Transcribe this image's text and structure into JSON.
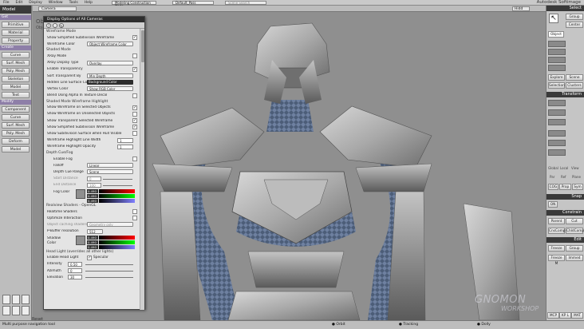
{
  "menubar": {
    "items": [
      "File",
      "Edit",
      "Display",
      "Window",
      "Tools",
      "Help"
    ],
    "mode_combo": "Modeling Construction Mode",
    "scene_combo": "Default_Pass",
    "search_placeholder": "Scene Search",
    "brand": "Autodesk Softimage"
  },
  "left_panel": {
    "header": "Model",
    "get_section": "Get",
    "get_buttons": [
      "Primitive",
      "Material",
      "Property"
    ],
    "create_section": "Create",
    "create_buttons": [
      "Curve",
      "Surf. Mesh",
      "Poly. Mesh",
      "Skeleton",
      "Model",
      "Text"
    ],
    "modify_section": "Modify",
    "modify_buttons": [
      "Component",
      "Curve",
      "Surf. Mesh",
      "Poly. Mesh",
      "Deform",
      "Model"
    ]
  },
  "viewport": {
    "camera_label": "Camera",
    "shading_label": "Hidd",
    "name_overlay": "Obje",
    "note_overlay": "Obje..."
  },
  "dialog": {
    "title": "Display Options of All Cameras",
    "sections": {
      "wireframe_mode": "Wireframe Mode",
      "shaded_mode": "Shaded Mode",
      "shaded_wire": "Shaded Mode Wireframe Highlight",
      "depth_cue": "Depth Cue/Fog",
      "realview": "Realview Shaders - OpenGL",
      "headlight": "Head Light (overrides all other lights)"
    },
    "wf_show_simplified": "Show Simplified Subdivision Wireframe",
    "wf_color_label": "Wireframe Color",
    "wf_color_value": "Object Wireframe Color",
    "xray_mode": "XRay Mode",
    "xray_type_label": "XRay Display Type",
    "xray_type_value": "Overlay",
    "enable_transparency": "Enable Transparency",
    "sort_transparent_label": "Sort Transparent By",
    "sort_transparent_value": "Min Depth",
    "hidden_line_label": "Hidden Line Surface Color",
    "hidden_line_value": "Background Color",
    "vertex_color_label": "Vertex Color",
    "vertex_color_value": "Show RGB Color",
    "blend_alpha": "Blend Using Alpha In Texture Decal",
    "swh_selected": "Show Wireframe on Selected Objects",
    "swh_unselected": "Show Wireframe on Unselected Objects",
    "swh_transparent": "Show Transparent Selected Wireframe",
    "swh_simplified": "Show Simplified Subdivision Wireframe",
    "swh_hull": "Show Subdivision Surface when Hull Visible",
    "wf_line_width_label": "Wireframe Highlight Line Width",
    "wf_line_width_value": "1",
    "wf_opacity_label": "Wireframe Highlight Opacity",
    "wf_opacity_value": "1",
    "enable_fog": "Enable Fog",
    "falloff_label": "Falloff",
    "falloff_value": "Linear",
    "depth_cue_range_label": "Depth Cue Range",
    "depth_cue_range_value": "Scene",
    "start_distance_label": "Start Distance",
    "start_distance_value": "0",
    "end_distance_label": "End Distance",
    "end_distance_value": "100",
    "fog_color_label": "Fog Color",
    "fog_rgb": [
      "0.490",
      "0.490",
      "0.490"
    ],
    "realtime_shaders": "Realtime Shaders",
    "optimize_interaction": "Optimize Interaction",
    "object_caching_label": "Object caching shaders",
    "object_caching_value": "Geometry only",
    "pbuffer_label": "P-Buffer resolution",
    "pbuffer_value": "512",
    "shadow_label": "Shadow",
    "shadow_color_label": "Color",
    "shadow_rgb": [
      "0.490",
      "0.490",
      "0.490"
    ],
    "enable_headlight": "Enable Head Light",
    "specular_label": "Specular",
    "intensity_label": "Intensity",
    "intensity_value": "0.50",
    "azimuth_label": "Azimuth",
    "azimuth_value": "0",
    "elevation_label": "Elevation",
    "elevation_value": "30"
  },
  "right_panel": {
    "select_header": "Select",
    "group_button": "Group",
    "center_button": "Center",
    "object_button": "Object",
    "explore_button": "Explore",
    "scene_button": "Scene",
    "selection_button": "Selection",
    "clusters_button": "Clusters",
    "transform_header": "Transform",
    "global_label": "Global",
    "local_label": "Local",
    "view_label": "View",
    "par_label": "Par",
    "ref_label": "Ref",
    "plane_label": "Plane",
    "cog_label": "COG",
    "prop_label": "Prop",
    "sym_label": "Sym",
    "snap_header": "Snap",
    "snap_on": "ON",
    "constrain_header": "Constrain",
    "parent_button": "Parent",
    "cut_button": "Cut",
    "cnscomp_button": "CnsComp",
    "chldcomp_button": "ChldComp",
    "edit_header": "Edit",
    "freeze_button": "Freeze",
    "group_edit_button": "Group",
    "freeze_m_button": "Freeze M",
    "immed_button": "Immed",
    "bottom_buttons": [
      "MCP",
      "KP L",
      "MAT"
    ]
  },
  "status": {
    "hint": "Multi purpose navigation tool",
    "orbit": "Orbit",
    "tracking": "Tracking",
    "dolly": "Dolly",
    "reset_label": "Reset"
  },
  "watermark": {
    "line1": "GNOMON",
    "line2": "WORKSHOP"
  }
}
